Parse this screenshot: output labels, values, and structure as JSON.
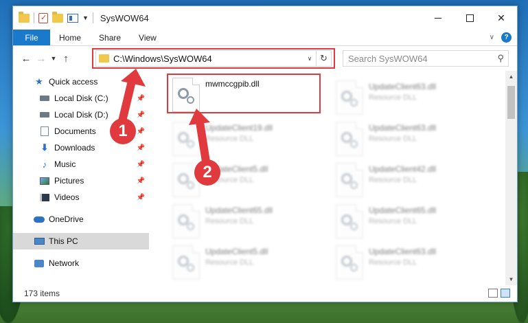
{
  "window": {
    "title": "SysWOW64"
  },
  "ribbon": {
    "file_tab": "File",
    "tabs": [
      "Home",
      "Share",
      "View"
    ],
    "help": "?"
  },
  "navigation": {
    "address_path": "C:\\Windows\\SysWOW64",
    "search_placeholder": "Search SysWOW64"
  },
  "sidebar": {
    "quick_access": "Quick access",
    "items": [
      {
        "label": "Local Disk (C:)",
        "icon": "drive-icon"
      },
      {
        "label": "Local Disk (D:)",
        "icon": "drive-icon"
      },
      {
        "label": "Documents",
        "icon": "documents-icon"
      },
      {
        "label": "Downloads",
        "icon": "downloads-icon"
      },
      {
        "label": "Music",
        "icon": "music-icon"
      },
      {
        "label": "Pictures",
        "icon": "pictures-icon"
      },
      {
        "label": "Videos",
        "icon": "videos-icon"
      }
    ],
    "onedrive": "OneDrive",
    "this_pc": "This PC",
    "network": "Network"
  },
  "files": {
    "highlighted": {
      "name": "mwmccgpib.dll"
    },
    "col1": [
      {
        "name": "UpdateClient19.dll",
        "type": "Resource DLL"
      },
      {
        "name": "UpdateClient5.dll",
        "type": "Resource DLL"
      },
      {
        "name": "UpdateClient65.dll",
        "type": "Resource DLL"
      },
      {
        "name": "UpdateClient5.dll",
        "type": "Resource DLL"
      }
    ],
    "col2": [
      {
        "name": "UpdateClient63.dll",
        "type": "Resource DLL"
      },
      {
        "name": "UpdateClient63.dll",
        "type": "Resource DLL"
      },
      {
        "name": "UpdateClient42.dll",
        "type": "Resource DLL"
      },
      {
        "name": "UpdateClient65.dll",
        "type": "Resource DLL"
      },
      {
        "name": "UpdateClient63.dll",
        "type": "Resource DLL"
      }
    ]
  },
  "status": {
    "item_count": "173 items"
  },
  "annotations": {
    "step1": "1",
    "step2": "2",
    "color": "#e0393e"
  },
  "colors": {
    "accent": "#1979ca",
    "highlight": "#e0393e",
    "selected_bg": "#d9d9d9"
  }
}
